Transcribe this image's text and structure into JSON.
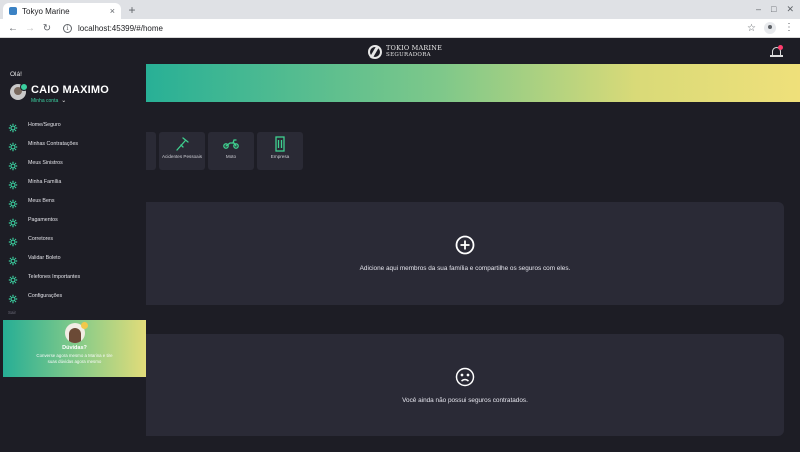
{
  "browser": {
    "tab_title": "Tokyo Marine",
    "tab_close": "×",
    "new_tab": "+",
    "window_controls": [
      "–",
      "□",
      "✕"
    ],
    "url": "localhost:45399/#/home"
  },
  "header": {
    "logo_line1": "TOKIO MARINE",
    "logo_line2": "SEGURADORA"
  },
  "sidebar": {
    "greeting": "Olá!",
    "user_name": "CAIO MAXIMO",
    "account_link": "Minha conta",
    "menu": [
      "Home/Seguro",
      "Minhas Contratações",
      "Meus Sinistros",
      "Minha Família",
      "Meus Bens",
      "Pagamentos",
      "Corretores",
      "Validar Boleto",
      "Telefones Importantes",
      "Configurações"
    ],
    "footer_label": "Sair",
    "help_card": {
      "title": "Dúvidas?",
      "text": "Converse agora mesmo a Marina e tire suas dúvidas agora mesmo"
    }
  },
  "categories": [
    {
      "label": "Acidentes Pessoais",
      "icon": "crutch-icon"
    },
    {
      "label": "Moto",
      "icon": "motorcycle-icon"
    },
    {
      "label": "Empresa",
      "icon": "building-icon"
    }
  ],
  "family_card": {
    "text": "Adicione aqui membros da sua família e compartilhe os seguros com eles."
  },
  "insurance_card": {
    "text": "Você ainda não possui seguros contratados."
  },
  "colors": {
    "accent": "#3bd0a0",
    "banner_start": "#28b096",
    "banner_end": "#efe07a",
    "background": "#1d1d25",
    "card": "#2a2a36"
  }
}
